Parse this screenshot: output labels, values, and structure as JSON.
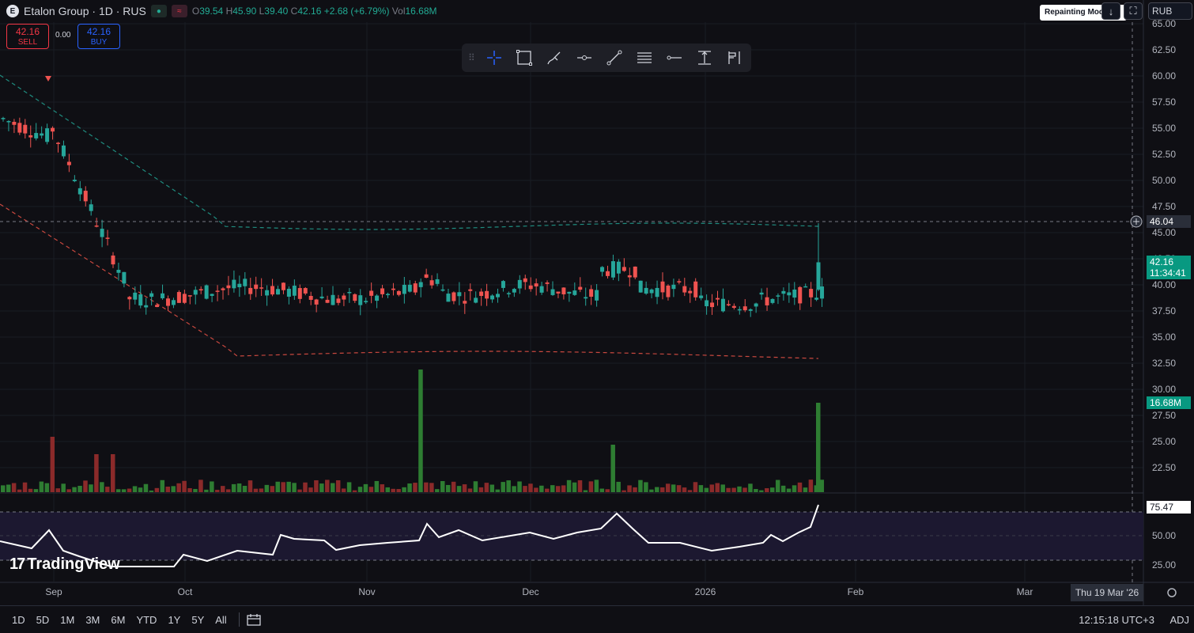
{
  "legend": {
    "logo_glyph": "E",
    "title": "Etalon Group · 1D · RUS",
    "status_badge": "≈",
    "open_label": "O",
    "open": "39.54",
    "high_label": "H",
    "high": "45.90",
    "low_label": "L",
    "low": "39.40",
    "close_label": "C",
    "close": "42.16",
    "change": "+2.68 (+6.79%)",
    "vol_label": "Vol",
    "vol": "16.68M"
  },
  "trade": {
    "sell_price": "42.16",
    "sell_label": "SELL",
    "spread": "0.00",
    "buy_price": "42.16",
    "buy_label": "BUY"
  },
  "toolbar_right": {
    "repainting": "Repainting Mode",
    "currency": "RUB",
    "down_icon": "arrow-down-icon",
    "fullscreen_icon": "fullscreen-icon"
  },
  "drawing_tools": [
    "crosshair-icon",
    "rectangle-icon",
    "brush-icon",
    "horizontal-ray-icon",
    "trend-line-icon",
    "fib-retracement-icon",
    "horizontal-line-icon",
    "price-range-icon",
    "long-position-icon"
  ],
  "price_axis": {
    "ticks": [
      "65.00",
      "62.50",
      "60.00",
      "57.50",
      "55.00",
      "52.50",
      "50.00",
      "47.50",
      "45.00",
      "42.50",
      "40.00",
      "37.50",
      "35.00",
      "32.50",
      "30.00",
      "27.50",
      "25.00",
      "22.50"
    ],
    "crosshair_price": "46.04",
    "last_price": "42.16",
    "countdown": "11:34:41",
    "volume_label": "16.68M"
  },
  "rsi": {
    "value": "75.47",
    "ticks": [
      "50.00",
      "25.00"
    ]
  },
  "time_axis": {
    "labels": [
      "Sep",
      "Oct",
      "Nov",
      "Dec",
      "2026",
      "Feb",
      "Mar"
    ],
    "hover_date": "Thu 19 Mar '26"
  },
  "watermark": "TradingView",
  "bottom_bar": {
    "ranges": [
      "1D",
      "5D",
      "1M",
      "3M",
      "6M",
      "YTD",
      "1Y",
      "5Y",
      "All"
    ],
    "clock": "12:15:18 UTC+3",
    "adj": "ADJ"
  },
  "colors": {
    "up": "#26a69a",
    "down": "#ef5350",
    "background": "#0f0f14",
    "rsi_band": "#1c1830",
    "upper_band": "#1f8c7f",
    "lower_band": "#c9483f"
  },
  "chart_data": {
    "type": "candlestick",
    "symbol": "Etalon Group",
    "interval": "1D",
    "price_range": [
      20.0,
      65.0
    ],
    "current": {
      "open": 39.54,
      "high": 45.9,
      "low": 39.4,
      "close": 42.16,
      "volume": "16.68M"
    }
  }
}
